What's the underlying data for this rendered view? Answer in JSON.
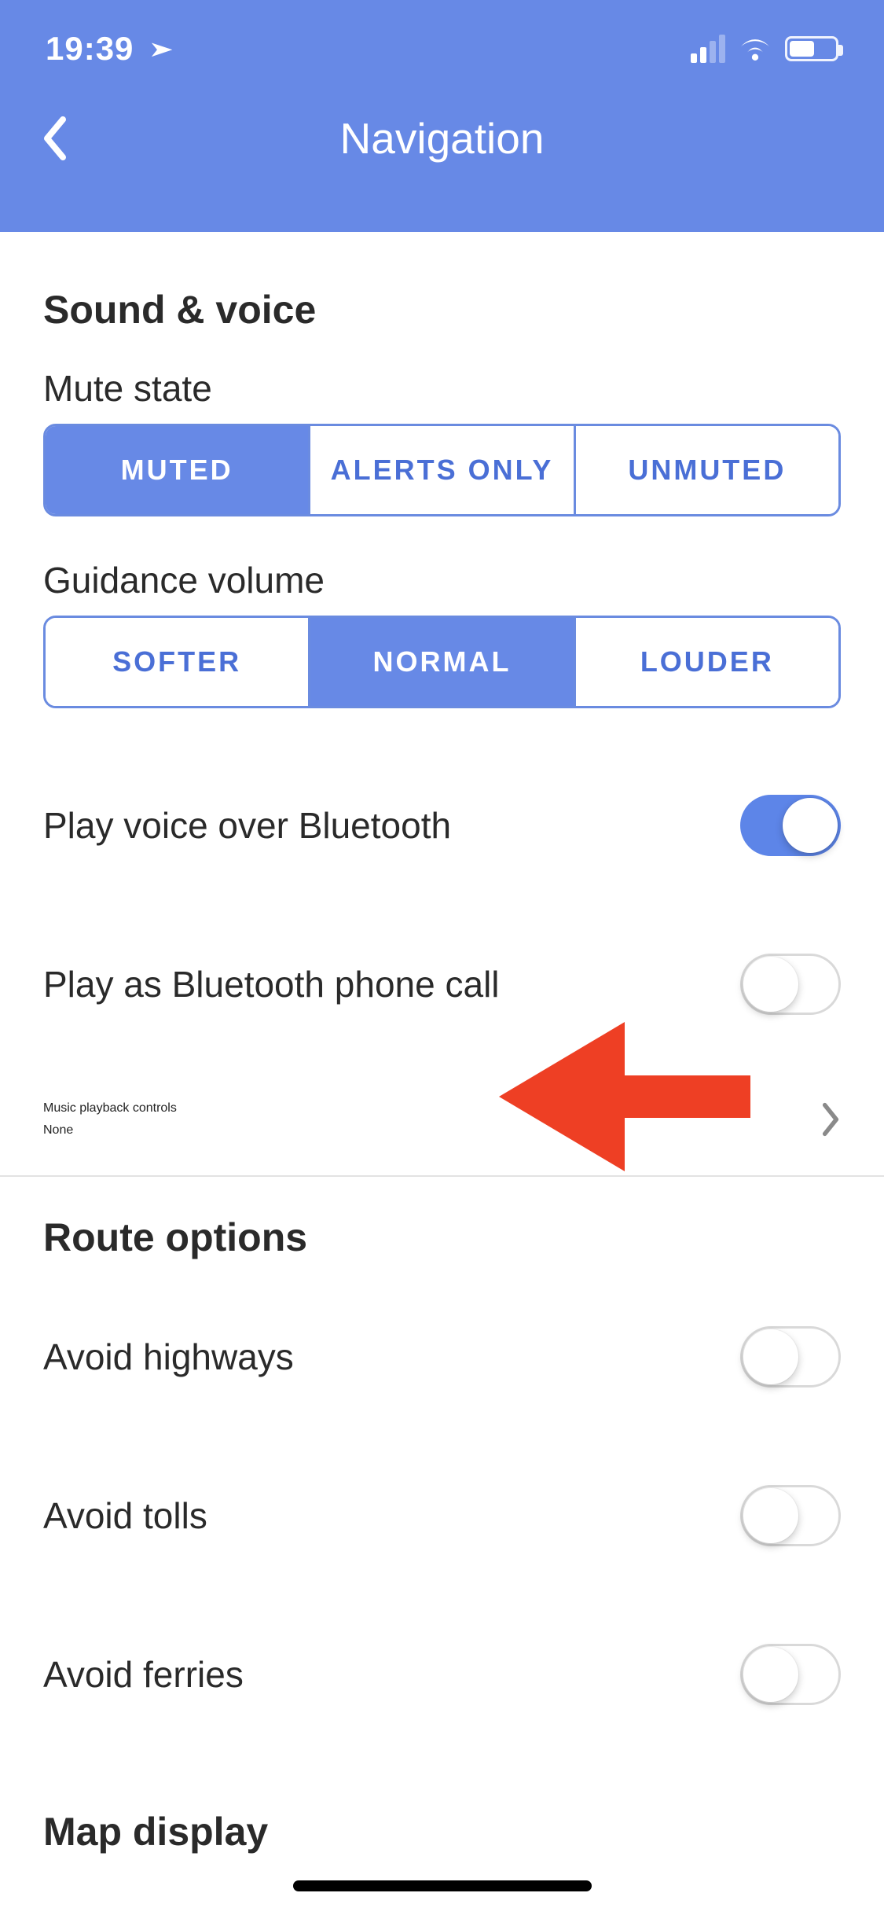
{
  "status": {
    "time": "19:39"
  },
  "header": {
    "title": "Navigation"
  },
  "sound": {
    "section": "Sound & voice",
    "mute_label": "Mute state",
    "mute_options": {
      "muted": "MUTED",
      "alerts": "ALERTS ONLY",
      "unmuted": "UNMUTED"
    },
    "mute_selected": "muted",
    "volume_label": "Guidance volume",
    "volume_options": {
      "softer": "SOFTER",
      "normal": "NORMAL",
      "louder": "LOUDER"
    },
    "volume_selected": "normal",
    "bluetooth_label": "Play voice over Bluetooth",
    "bluetooth_on": true,
    "phonecall_label": "Play as Bluetooth phone call",
    "phonecall_on": false,
    "music_label": "Music playback controls",
    "music_value": "None"
  },
  "route": {
    "section": "Route options",
    "highways_label": "Avoid highways",
    "highways_on": false,
    "tolls_label": "Avoid tolls",
    "tolls_on": false,
    "ferries_label": "Avoid ferries",
    "ferries_on": false
  },
  "map": {
    "section": "Map display"
  },
  "colors": {
    "accent": "#6789e6",
    "arrow": "#ee3f24"
  }
}
